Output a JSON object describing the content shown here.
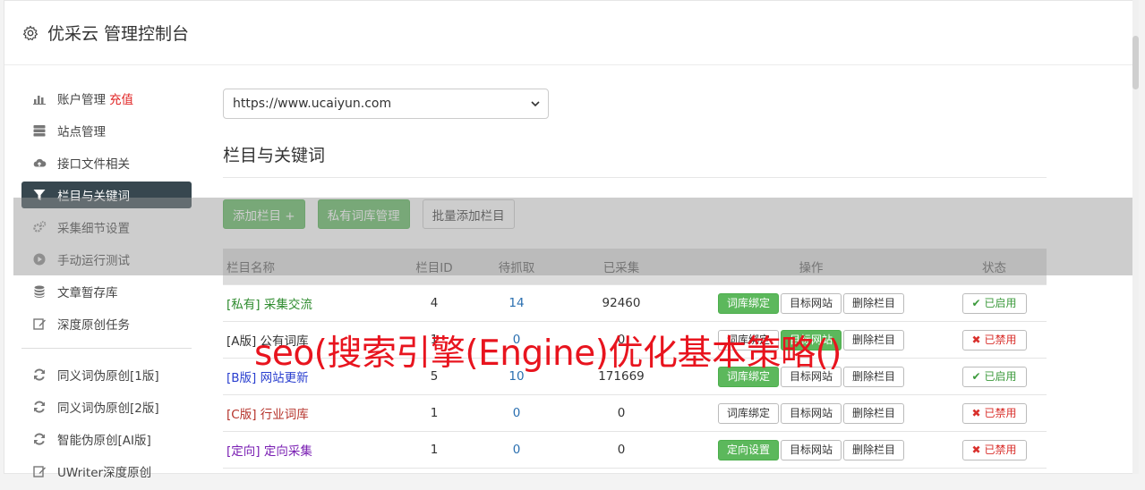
{
  "header": {
    "title": "优采云 管理控制台",
    "icon": "gear-icon"
  },
  "sidebar": {
    "items": [
      {
        "label": "账户管理",
        "extra": "充值",
        "icon": "bar-chart-icon"
      },
      {
        "label": "站点管理",
        "icon": "server-icon"
      },
      {
        "label": "接口文件相关",
        "icon": "cloud-upload-icon"
      },
      {
        "label": "栏目与关键词",
        "icon": "filter-icon",
        "active": true
      },
      {
        "label": "采集细节设置",
        "icon": "cogs-icon"
      },
      {
        "label": "手动运行测试",
        "icon": "play-circle-icon"
      },
      {
        "label": "文章暂存库",
        "icon": "database-icon"
      },
      {
        "label": "深度原创任务",
        "icon": "edit-icon"
      }
    ],
    "items2": [
      {
        "label": "同义词伪原创[1版]",
        "icon": "refresh-icon"
      },
      {
        "label": "同义词伪原创[2版]",
        "icon": "refresh-icon"
      },
      {
        "label": "智能伪原创[AI版]",
        "icon": "refresh-icon"
      },
      {
        "label": "UWriter深度原创",
        "icon": "edit-icon"
      }
    ]
  },
  "site_select": {
    "value": "https://www.ucaiyun.com"
  },
  "section": {
    "title": "栏目与关键词"
  },
  "buttons": {
    "add_column": "添加栏目 +",
    "private_lexicon": "私有词库管理",
    "batch_add": "批量添加栏目"
  },
  "table": {
    "headers": {
      "name": "栏目名称",
      "id": "栏目ID",
      "pending": "待抓取",
      "collected": "已采集",
      "ops": "操作",
      "status": "状态"
    },
    "rows": [
      {
        "name": "[私有] 采集交流",
        "name_color": "#2e8b2e",
        "id": "4",
        "pending": "14",
        "collected": "92460",
        "op1": "词库绑定",
        "op1_active": true,
        "op2": "目标网站",
        "op2_active": false,
        "op3": "删除栏目",
        "status_mark": "✔",
        "status": "已启用",
        "enabled": true
      },
      {
        "name": "[A版] 公有词库",
        "name_color": "#333333",
        "id": "1",
        "pending": "0",
        "collected": "0",
        "op1": "词库绑定",
        "op1_active": false,
        "op2": "目标网站",
        "op2_active": true,
        "op3": "删除栏目",
        "status_mark": "✖",
        "status": "已禁用",
        "enabled": false
      },
      {
        "name": "[B版] 网站更新",
        "name_color": "#2a3fcf",
        "id": "5",
        "pending": "10",
        "collected": "171669",
        "op1": "词库绑定",
        "op1_active": true,
        "op2": "目标网站",
        "op2_active": false,
        "op3": "删除栏目",
        "status_mark": "✔",
        "status": "已启用",
        "enabled": true
      },
      {
        "name": "[C版] 行业词库",
        "name_color": "#b5322a",
        "id": "1",
        "pending": "0",
        "collected": "0",
        "op1": "词库绑定",
        "op1_active": false,
        "op2": "目标网站",
        "op2_active": false,
        "op3": "删除栏目",
        "status_mark": "✖",
        "status": "已禁用",
        "enabled": false
      },
      {
        "name": "[定向] 定向采集",
        "name_color": "#7a1fb3",
        "id": "1",
        "pending": "0",
        "collected": "0",
        "op1": "定向设置",
        "op1_active": true,
        "op2": "目标网站",
        "op2_active": false,
        "op3": "删除栏目",
        "status_mark": "✖",
        "status": "已禁用",
        "enabled": false
      }
    ]
  },
  "watermark": {
    "text": "seo(搜索引擎(Engine)优化基本策略()"
  },
  "colors": {
    "accent_green": "#5cb85c",
    "active_nav": "#37474f",
    "watermark_red": "#e8141e"
  }
}
